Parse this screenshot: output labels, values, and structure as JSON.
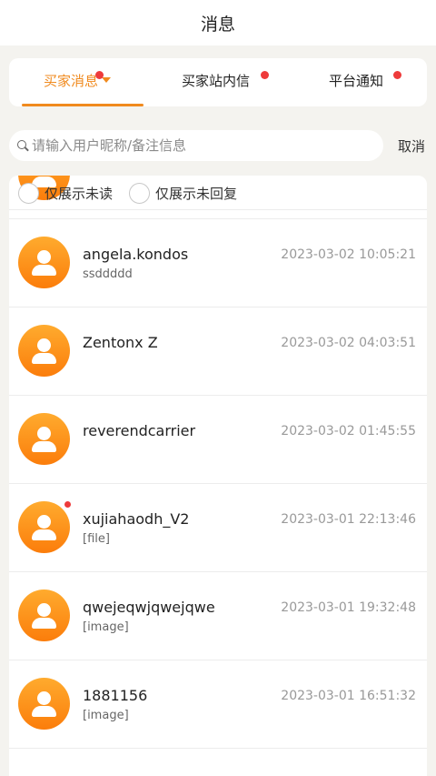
{
  "header": {
    "title": "消息"
  },
  "tabs": [
    {
      "label": "买家消息",
      "active": true,
      "has_dot": true,
      "has_caret": true
    },
    {
      "label": "买家站内信",
      "active": false,
      "has_dot": true,
      "has_caret": false
    },
    {
      "label": "平台通知",
      "active": false,
      "has_dot": true,
      "has_caret": false
    }
  ],
  "search": {
    "placeholder": "请输入用户昵称/备注信息",
    "value": "",
    "cancel_label": "取消"
  },
  "filters": [
    {
      "label": "仅展示未读",
      "checked": false
    },
    {
      "label": "仅展示未回复",
      "checked": false
    }
  ],
  "messages": [
    {
      "name": "",
      "time": "",
      "preview": "",
      "unread": false
    },
    {
      "name": "angela.kondos",
      "time": "2023-03-02 10:05:21",
      "preview": "ssddddd",
      "unread": false
    },
    {
      "name": "Zentonx Z",
      "time": "2023-03-02 04:03:51",
      "preview": "",
      "unread": false
    },
    {
      "name": "reverendcarrier",
      "time": "2023-03-02 01:45:55",
      "preview": "",
      "unread": false
    },
    {
      "name": "xujiahaodh_V2",
      "time": "2023-03-01 22:13:46",
      "preview": "[file]",
      "unread": true
    },
    {
      "name": "qwejeqwjqwejqwe",
      "time": "2023-03-01 19:32:48",
      "preview": "[image]",
      "unread": false
    },
    {
      "name": "1881156",
      "time": "2023-03-01 16:51:32",
      "preview": "[image]",
      "unread": false
    }
  ],
  "colors": {
    "accent": "#f08a1e",
    "unread_dot": "#ee3b3b",
    "background": "#f4f3ef"
  }
}
